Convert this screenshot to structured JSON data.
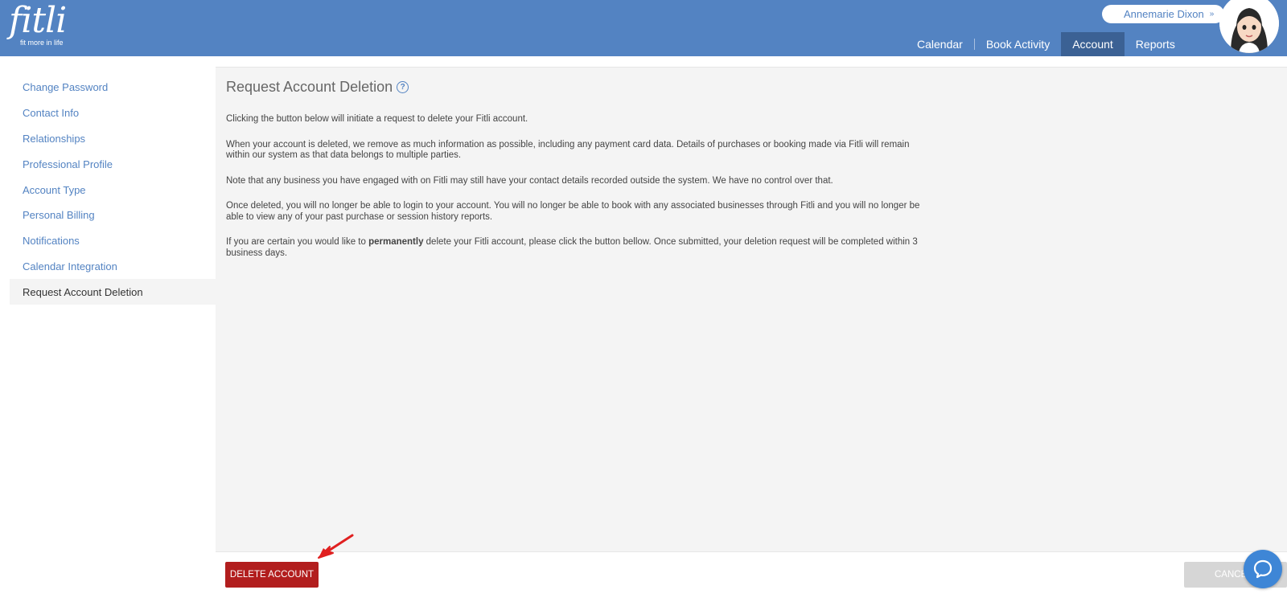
{
  "brand": {
    "logo_text": "fitli",
    "tagline": "fit more in life"
  },
  "user": {
    "name": "Annemarie Dixon"
  },
  "nav": {
    "tabs": [
      {
        "label": "Calendar"
      },
      {
        "label": "Book Activity"
      },
      {
        "label": "Account"
      },
      {
        "label": "Reports"
      }
    ],
    "active": "Account"
  },
  "sidebar": {
    "items": [
      {
        "label": "Change Password"
      },
      {
        "label": "Contact Info"
      },
      {
        "label": "Relationships"
      },
      {
        "label": "Professional Profile"
      },
      {
        "label": "Account Type"
      },
      {
        "label": "Personal Billing"
      },
      {
        "label": "Notifications"
      },
      {
        "label": "Calendar Integration"
      },
      {
        "label": "Request Account Deletion"
      }
    ],
    "active": "Request Account Deletion"
  },
  "main": {
    "title": "Request Account Deletion",
    "paragraphs": [
      "Clicking the button below will initiate a request to delete your Fitli account.",
      "When your account is deleted, we remove as much information as possible, including any payment card data. Details of purchases or booking made via Fitli will remain within our system as that data belongs to multiple parties.",
      "Note that any business you have engaged with on Fitli may still have your contact details recorded outside the system. We have no control over that.",
      "Once deleted, you will no longer be able to login to your account. You will no longer be able to book with any associated businesses through Fitli and you will no longer be able to view any of your past purchase or session history reports."
    ],
    "final_paragraph": {
      "before": "If you are certain you would like to ",
      "bold": "permanently",
      "after": " delete your Fitli account, please click the button bellow. Once submitted, your deletion request will be completed within 3 business days."
    }
  },
  "footer": {
    "delete_label": "DELETE ACCOUNT",
    "cancel_label": "CANCEL"
  },
  "colors": {
    "header": "#5383c2",
    "active_tab": "#3b6194",
    "delete": "#b21e1e",
    "chat": "#3e86d6"
  }
}
